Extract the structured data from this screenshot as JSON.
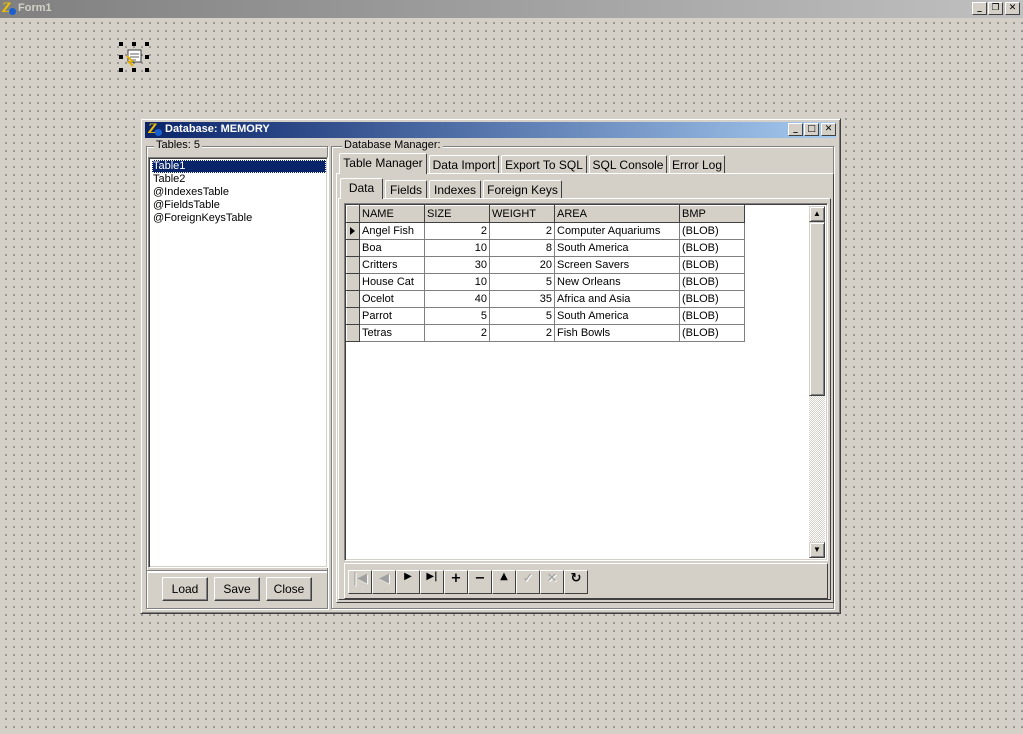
{
  "form": {
    "title": "Form1"
  },
  "window": {
    "title": "Database: MEMORY"
  },
  "tables": {
    "label": "Tables: 5",
    "items": [
      "Table1",
      "Table2",
      "@IndexesTable",
      "@FieldsTable",
      "@ForeignKeysTable"
    ]
  },
  "buttons": {
    "load": "Load",
    "save": "Save",
    "close": "Close"
  },
  "manager": {
    "label": "Database Manager:",
    "tabs": [
      "Table Manager",
      "Data Import",
      "Export To SQL",
      "SQL Console",
      "Error Log"
    ],
    "subtabs": [
      "Data",
      "Fields",
      "Indexes",
      "Foreign Keys"
    ]
  },
  "grid": {
    "columns": [
      "NAME",
      "SIZE",
      "WEIGHT",
      "AREA",
      "BMP"
    ],
    "rows": [
      [
        "Angel Fish",
        "2",
        "2",
        "Computer Aquariums",
        "(BLOB)"
      ],
      [
        "Boa",
        "10",
        "8",
        "South America",
        "(BLOB)"
      ],
      [
        "Critters",
        "30",
        "20",
        "Screen Savers",
        "(BLOB)"
      ],
      [
        "House Cat",
        "10",
        "5",
        "New Orleans",
        "(BLOB)"
      ],
      [
        "Ocelot",
        "40",
        "35",
        "Africa and Asia",
        "(BLOB)"
      ],
      [
        "Parrot",
        "5",
        "5",
        "South America",
        "(BLOB)"
      ],
      [
        "Tetras",
        "2",
        "2",
        "Fish Bowls",
        "(BLOB)"
      ]
    ]
  },
  "navigator": {
    "buttons": [
      {
        "icon": "first-record-icon",
        "glyph": "|◀",
        "enabled": false
      },
      {
        "icon": "prior-record-icon",
        "glyph": "◀",
        "enabled": false
      },
      {
        "icon": "next-record-icon",
        "glyph": "▶",
        "enabled": true
      },
      {
        "icon": "last-record-icon",
        "glyph": "▶|",
        "enabled": true
      },
      {
        "icon": "insert-record-icon",
        "glyph": "+",
        "enabled": true
      },
      {
        "icon": "delete-record-icon",
        "glyph": "−",
        "enabled": true
      },
      {
        "icon": "edit-record-icon",
        "glyph": "▲",
        "enabled": true
      },
      {
        "icon": "post-record-icon",
        "glyph": "✓",
        "enabled": false
      },
      {
        "icon": "cancel-record-icon",
        "glyph": "✕",
        "enabled": false
      },
      {
        "icon": "refresh-record-icon",
        "glyph": "↻",
        "enabled": true
      }
    ]
  }
}
